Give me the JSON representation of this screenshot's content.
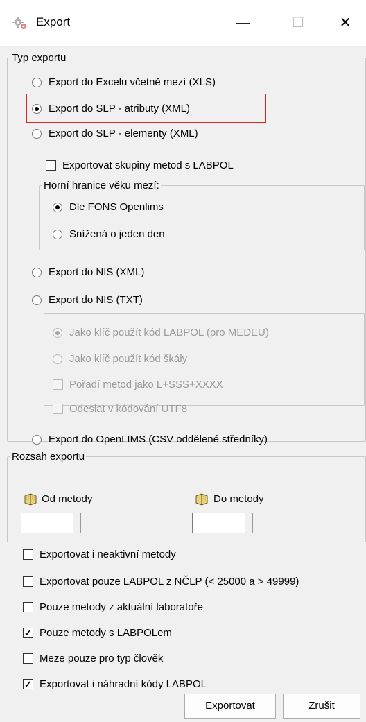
{
  "window": {
    "title": "Export",
    "minimize_glyph": "—",
    "maximize_glyph": "☐",
    "close_glyph": "✕"
  },
  "typ_exportu": {
    "legend": "Typ exportu",
    "options": [
      {
        "label": "Export do Excelu včetně mezí (XLS)",
        "checked": false
      },
      {
        "label": "Export do SLP - atributy (XML)",
        "checked": true
      },
      {
        "label": "Export do SLP - elementy (XML)",
        "checked": false
      }
    ],
    "skupiny_check": {
      "label": "Exportovat skupiny metod s LABPOL",
      "checked": false
    },
    "horni_hranice": {
      "legend": "Horní hranice věku mezí:",
      "options": [
        {
          "label": "Dle FONS Openlims",
          "checked": true
        },
        {
          "label": "Snížená o jeden den",
          "checked": false
        }
      ]
    },
    "nis_options": [
      {
        "label": "Export do NIS (XML)",
        "checked": false
      },
      {
        "label": "Export do NIS (TXT)",
        "checked": false
      }
    ],
    "nis_txt_group": {
      "options": [
        {
          "label": "Jako klíč použít kód LABPOL (pro MEDEU)",
          "checked": true
        },
        {
          "label": "Jako klíč použít kód škály",
          "checked": false
        }
      ],
      "checks": [
        {
          "label": "Pořadí metod jako L+SSS+XXXX",
          "checked": false
        },
        {
          "label": "Odeslat v kódování UTF8",
          "checked": false
        }
      ]
    },
    "openlims_option": {
      "label": "Export do OpenLIMS (CSV oddělené středníky)",
      "checked": false
    }
  },
  "rozsah_exportu": {
    "legend": "Rozsah exportu",
    "od_metody_label": "Od metody",
    "do_metody_label": "Do metody",
    "book_icon": "book-icon",
    "od_code": "",
    "od_name": "",
    "do_code": "",
    "do_name": ""
  },
  "options": [
    {
      "label": "Exportovat i neaktivní metody",
      "checked": false
    },
    {
      "label": "Exportovat pouze LABPOL z NČLP (< 25000 a > 49999)",
      "checked": false
    },
    {
      "label": "Pouze metody z aktuální laboratoře",
      "checked": false
    },
    {
      "label": "Pouze metody s LABPOLem",
      "checked": true
    },
    {
      "label": "Meze pouze pro typ člověk",
      "checked": false
    },
    {
      "label": "Exportovat i náhradní kódy LABPOL",
      "checked": true
    }
  ],
  "buttons": {
    "export_label": "Exportovat",
    "cancel_label": "Zrušit"
  },
  "colors": {
    "highlight_border": "#e02424",
    "window_bg": "#f0f0f0",
    "book_icon_fill": "#e8d27a"
  }
}
